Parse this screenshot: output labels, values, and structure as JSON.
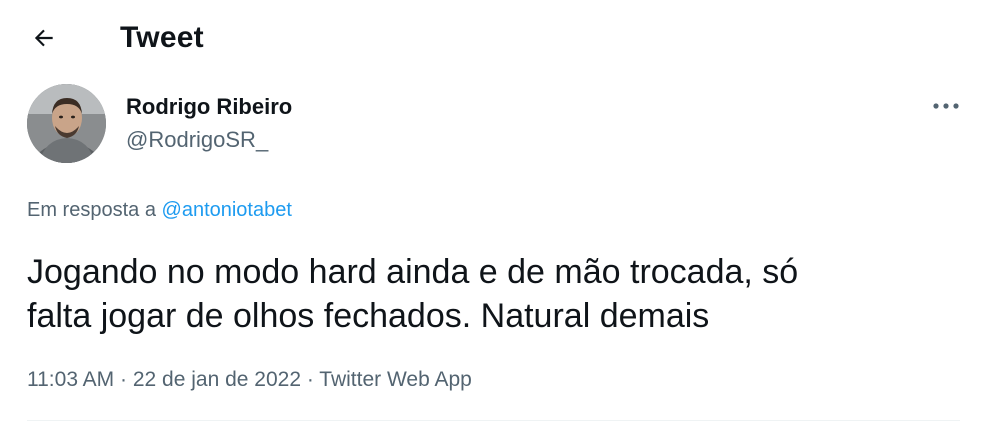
{
  "header": {
    "title": "Tweet",
    "back_icon": "arrow-left-icon"
  },
  "author": {
    "display_name": "Rodrigo Ribeiro",
    "handle": "@RodrigoSR_",
    "avatar_icon": "user-avatar"
  },
  "reply": {
    "prefix": "Em resposta a ",
    "mention": "@antoniotabet"
  },
  "tweet": {
    "text": "Jogando no modo hard ainda e de mão trocada, só\nfalta jogar de olhos fechados. Natural demais",
    "time": "11:03 AM",
    "separator1": " · ",
    "date": "22 de jan de 2022",
    "separator2": " · ",
    "source": "Twitter Web App"
  },
  "more_icon": "more-horizontal-icon",
  "colors": {
    "text": "#0f1419",
    "secondary": "#536471",
    "link": "#1d9bf0"
  }
}
